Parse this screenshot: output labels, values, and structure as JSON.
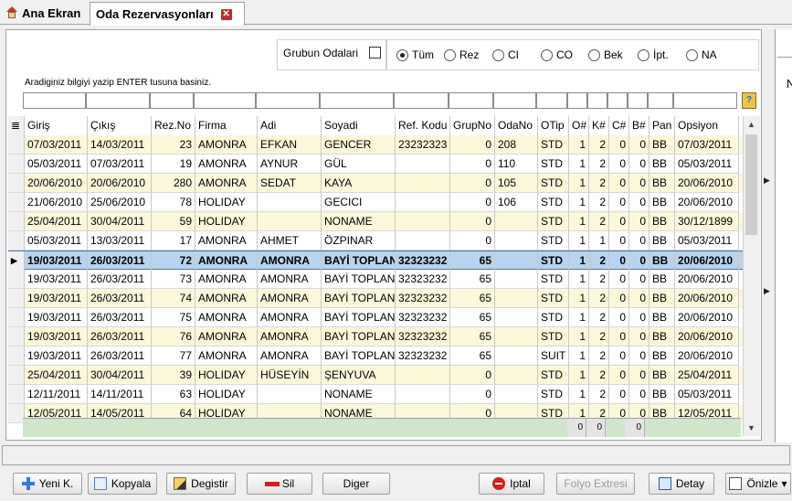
{
  "tabs": [
    {
      "label": "Ana Ekran",
      "icon": "home-icon"
    },
    {
      "label": "Oda Rezervasyonları",
      "icon": "close-icon"
    }
  ],
  "group": {
    "label": "Grubun Odalari"
  },
  "radios": [
    {
      "label": "Tüm",
      "selected": true
    },
    {
      "label": "Rez",
      "selected": false
    },
    {
      "label": "CI",
      "selected": false
    },
    {
      "label": "CO",
      "selected": false
    },
    {
      "label": "Bek",
      "selected": false
    },
    {
      "label": "İpt.",
      "selected": false
    },
    {
      "label": "NA",
      "selected": false
    }
  ],
  "hint": "Aradiginiz bilgiyi yazip ENTER tusuna basiniz.",
  "columns": [
    "Giriş",
    "Çıkış",
    "Rez.No",
    "Firma",
    "Adi",
    "Soyadi",
    "Ref. Kodu",
    "GrupNo",
    "OdaNo",
    "OTip",
    "O#",
    "K#",
    "C#",
    "B#",
    "Pan",
    "Opsiyon"
  ],
  "rows": [
    [
      "07/03/2011",
      "14/03/2011",
      "23",
      "AMONRA",
      "EFKAN",
      "GENCER",
      "23232323",
      "0",
      "208",
      "STD",
      "1",
      "2",
      "0",
      "0",
      "BB",
      "07/03/2011"
    ],
    [
      "05/03/2011",
      "07/03/2011",
      "19",
      "AMONRA",
      "AYNUR",
      "GÜL",
      "",
      "0",
      "110",
      "STD",
      "1",
      "2",
      "0",
      "0",
      "BB",
      "05/03/2011"
    ],
    [
      "20/06/2010",
      "20/06/2010",
      "280",
      "AMONRA",
      "SEDAT",
      "KAYA",
      "",
      "0",
      "105",
      "STD",
      "1",
      "2",
      "0",
      "0",
      "BB",
      "20/06/2010"
    ],
    [
      "21/06/2010",
      "25/06/2010",
      "78",
      "HOLIDAY",
      "",
      "GECICI",
      "",
      "0",
      "106",
      "STD",
      "1",
      "2",
      "0",
      "0",
      "BB",
      "20/06/2010"
    ],
    [
      "25/04/2011",
      "30/04/2011",
      "59",
      "HOLIDAY",
      "",
      "NONAME",
      "",
      "0",
      "",
      "STD",
      "1",
      "2",
      "0",
      "0",
      "BB",
      "30/12/1899"
    ],
    [
      "05/03/2011",
      "13/03/2011",
      "17",
      "AMONRA",
      "AHMET",
      "ÖZPINAR",
      "",
      "0",
      "",
      "STD",
      "1",
      "1",
      "0",
      "0",
      "BB",
      "05/03/2011"
    ],
    [
      "19/03/2011",
      "26/03/2011",
      "72",
      "AMONRA",
      "AMONRA",
      "BAYİ TOPLAN",
      "32323232",
      "65",
      "",
      "STD",
      "1",
      "2",
      "0",
      "0",
      "BB",
      "20/06/2010"
    ],
    [
      "19/03/2011",
      "26/03/2011",
      "73",
      "AMONRA",
      "AMONRA",
      "BAYİ TOPLAN'",
      "32323232",
      "65",
      "",
      "STD",
      "1",
      "2",
      "0",
      "0",
      "BB",
      "20/06/2010"
    ],
    [
      "19/03/2011",
      "26/03/2011",
      "74",
      "AMONRA",
      "AMONRA",
      "BAYİ TOPLAN'",
      "32323232",
      "65",
      "",
      "STD",
      "1",
      "2",
      "0",
      "0",
      "BB",
      "20/06/2010"
    ],
    [
      "19/03/2011",
      "26/03/2011",
      "75",
      "AMONRA",
      "AMONRA",
      "BAYİ TOPLAN'",
      "32323232",
      "65",
      "",
      "STD",
      "1",
      "2",
      "0",
      "0",
      "BB",
      "20/06/2010"
    ],
    [
      "19/03/2011",
      "26/03/2011",
      "76",
      "AMONRA",
      "AMONRA",
      "BAYİ TOPLAN'",
      "32323232",
      "65",
      "",
      "STD",
      "1",
      "2",
      "0",
      "0",
      "BB",
      "20/06/2010"
    ],
    [
      "19/03/2011",
      "26/03/2011",
      "77",
      "AMONRA",
      "AMONRA",
      "BAYİ TOPLAN'",
      "32323232",
      "65",
      "",
      "SUIT",
      "1",
      "2",
      "0",
      "0",
      "BB",
      "20/06/2010"
    ],
    [
      "25/04/2011",
      "30/04/2011",
      "39",
      "HOLIDAY",
      "HÜSEYİN",
      "ŞENYUVA",
      "",
      "0",
      "",
      "STD",
      "1",
      "2",
      "0",
      "0",
      "BB",
      "25/04/2011"
    ],
    [
      "12/11/2011",
      "14/11/2011",
      "63",
      "HOLIDAY",
      "",
      "NONAME",
      "",
      "0",
      "",
      "STD",
      "1",
      "2",
      "0",
      "0",
      "BB",
      "05/03/2011"
    ],
    [
      "12/05/2011",
      "14/05/2011",
      "64",
      "HOLIDAY",
      "",
      "NONAME",
      "",
      "0",
      "",
      "STD",
      "1",
      "2",
      "0",
      "0",
      "BB",
      "12/05/2011"
    ]
  ],
  "selected_row": 6,
  "totals": {
    "k": "0",
    "c": "0",
    "b": "0"
  },
  "right_letter": "N",
  "buttons": [
    {
      "label": "Yeni K.",
      "icon": "plus-icon",
      "disabled": false
    },
    {
      "label": "Kopyala",
      "icon": "copy-icon",
      "disabled": false
    },
    {
      "label": "Degistir",
      "icon": "edit-icon",
      "disabled": false
    },
    {
      "label": "Sil",
      "icon": "minus-icon",
      "disabled": false
    },
    {
      "label": "Diger",
      "icon": "",
      "disabled": false
    },
    {
      "label": "Iptal",
      "icon": "stop-icon",
      "disabled": false
    },
    {
      "label": "Folyo Extresi",
      "icon": "",
      "disabled": true
    },
    {
      "label": "Detay",
      "icon": "detail-icon",
      "disabled": false
    },
    {
      "label": "Önizle",
      "icon": "preview-icon",
      "disabled": false
    }
  ]
}
